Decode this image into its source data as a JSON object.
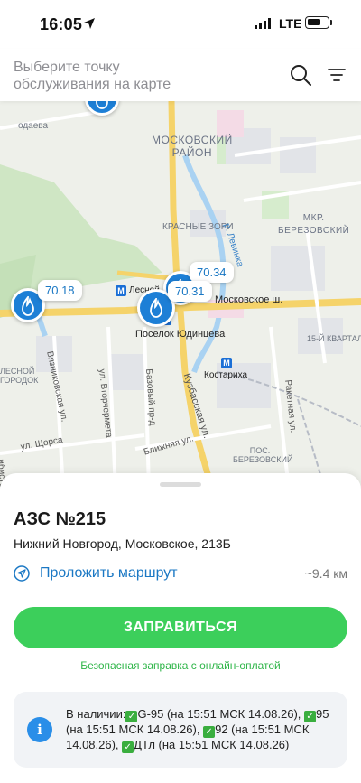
{
  "status_bar": {
    "time": "16:05",
    "network": "LTE"
  },
  "search": {
    "placeholder": "Выберите точку обслуживания на карте",
    "search_icon": "search-icon",
    "menu_icon": "filter-menu-icon"
  },
  "map": {
    "districts": [
      "МОСКОВСКИЙ РАЙОН",
      "МКР. БЕРЕЗОВСКИЙ"
    ],
    "labels": {
      "krasnye_zori": "КРАСНЫЕ ЗОРИ",
      "lesnoy": "Лесной",
      "poselok": "Поселок Юдинцева",
      "moskovskoe": "Московское ш.",
      "kostariha": "Костариха",
      "kvartal": "15-Й КВАРТАЛ",
      "pos_berezovskiy": "ПОС. БЕРЕЗОВСКИЙ",
      "lesnoy_gorodok": "ЛЕСНОЙ ГОРОДОК",
      "levinka": "р. Левинка",
      "vyaznikovskaya": "Вязниковская ул.",
      "vtorchermeta": "ул. Вторчермета",
      "bazovy": "Базовый пр-д",
      "blizhnyaya": "Ближняя ул.",
      "kuzbasskaya": "Кузбасская ул.",
      "raketnaya": "Ракетная ул.",
      "shchorsa": "ул. Щорса",
      "odaeva": "одаева",
      "mirnaya": "ибистов"
    },
    "prices": [
      "70.18",
      "70.34",
      "70.31"
    ],
    "brand_color": "#1d7fd6"
  },
  "station": {
    "title": "АЗС №215",
    "address": "Нижний Новгород, Московское, 213Б",
    "route_label": "Проложить маршрут",
    "distance": "~9.4 км",
    "refuel_button": "ЗАПРАВИТЬСЯ",
    "safe_note": "Безопасная заправка с онлайн-оплатой",
    "availability": {
      "prefix": "В наличии:",
      "items": [
        "G-95 (на 15:51 МСК 14.08.26),",
        "95 (на 15:51 МСК 14.08.26),",
        "92 (на 15:51 МСК 14.08.26),",
        "ДТл (на 15:51 МСК 14.08.26)"
      ]
    }
  },
  "colors": {
    "accent_green": "#3ccf5b",
    "link_blue": "#1b78c4"
  }
}
